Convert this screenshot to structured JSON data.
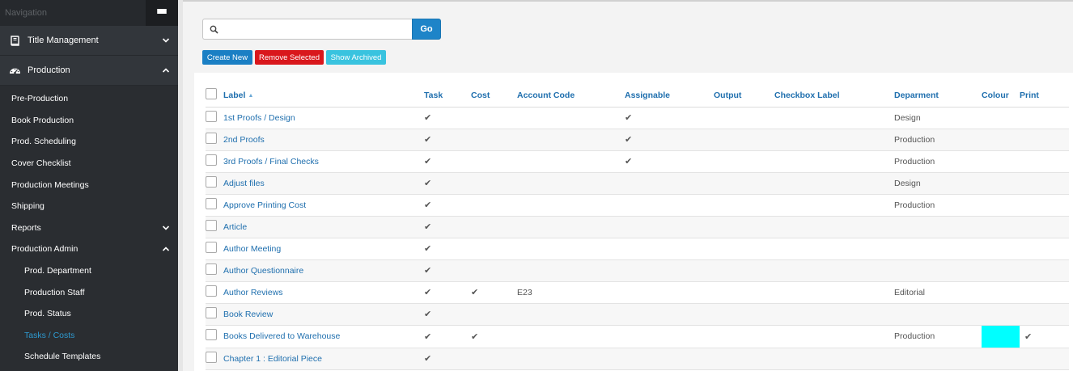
{
  "sidebar": {
    "nav_title": "Navigation",
    "sections": [
      {
        "label": "Title Management",
        "icon": "book-icon",
        "expanded": false
      },
      {
        "label": "Production",
        "icon": "dashboard-icon",
        "expanded": true
      }
    ],
    "items": [
      {
        "label": "Pre-Production",
        "nested": false,
        "chevron": ""
      },
      {
        "label": "Book Production",
        "nested": false,
        "chevron": ""
      },
      {
        "label": "Prod. Scheduling",
        "nested": false,
        "chevron": ""
      },
      {
        "label": "Cover Checklist",
        "nested": false,
        "chevron": ""
      },
      {
        "label": "Production Meetings",
        "nested": false,
        "chevron": ""
      },
      {
        "label": "Shipping",
        "nested": false,
        "chevron": ""
      },
      {
        "label": "Reports",
        "nested": false,
        "chevron": "down"
      },
      {
        "label": "Production Admin",
        "nested": false,
        "chevron": "up"
      },
      {
        "label": "Prod. Department",
        "nested": true,
        "chevron": ""
      },
      {
        "label": "Production Staff",
        "nested": true,
        "chevron": ""
      },
      {
        "label": "Prod. Status",
        "nested": true,
        "chevron": ""
      },
      {
        "label": "Tasks / Costs",
        "nested": true,
        "chevron": "",
        "active": true
      },
      {
        "label": "Schedule Templates",
        "nested": true,
        "chevron": ""
      }
    ]
  },
  "search": {
    "value": "",
    "placeholder": "",
    "go_label": "Go"
  },
  "actions": {
    "create_new": "Create New",
    "remove_selected": "Remove Selected",
    "show_archived": "Show Archived"
  },
  "table": {
    "columns": {
      "label": "Label",
      "task": "Task",
      "cost": "Cost",
      "account_code": "Account Code",
      "assignable": "Assignable",
      "output": "Output",
      "checkbox_label": "Checkbox Label",
      "department": "Deparment",
      "colour": "Colour",
      "print": "Print"
    },
    "sort_column": "label",
    "sort_direction": "ascending",
    "rows": [
      {
        "label": "1st Proofs / Design",
        "task": true,
        "cost": false,
        "account_code": "",
        "assignable": true,
        "output": "",
        "checkbox_label": "",
        "department": "Design",
        "colour": "",
        "print": false
      },
      {
        "label": "2nd Proofs",
        "task": true,
        "cost": false,
        "account_code": "",
        "assignable": true,
        "output": "",
        "checkbox_label": "",
        "department": "Production",
        "colour": "",
        "print": false
      },
      {
        "label": "3rd Proofs / Final Checks",
        "task": true,
        "cost": false,
        "account_code": "",
        "assignable": true,
        "output": "",
        "checkbox_label": "",
        "department": "Production",
        "colour": "",
        "print": false
      },
      {
        "label": "Adjust files",
        "task": true,
        "cost": false,
        "account_code": "",
        "assignable": false,
        "output": "",
        "checkbox_label": "",
        "department": "Design",
        "colour": "",
        "print": false
      },
      {
        "label": "Approve Printing Cost",
        "task": true,
        "cost": false,
        "account_code": "",
        "assignable": false,
        "output": "",
        "checkbox_label": "",
        "department": "Production",
        "colour": "",
        "print": false
      },
      {
        "label": "Article",
        "task": true,
        "cost": false,
        "account_code": "",
        "assignable": false,
        "output": "",
        "checkbox_label": "",
        "department": "",
        "colour": "",
        "print": false
      },
      {
        "label": "Author Meeting",
        "task": true,
        "cost": false,
        "account_code": "",
        "assignable": false,
        "output": "",
        "checkbox_label": "",
        "department": "",
        "colour": "",
        "print": false
      },
      {
        "label": "Author Questionnaire",
        "task": true,
        "cost": false,
        "account_code": "",
        "assignable": false,
        "output": "",
        "checkbox_label": "",
        "department": "",
        "colour": "",
        "print": false
      },
      {
        "label": "Author Reviews",
        "task": true,
        "cost": true,
        "account_code": "E23",
        "assignable": false,
        "output": "",
        "checkbox_label": "",
        "department": "Editorial",
        "colour": "",
        "print": false
      },
      {
        "label": "Book Review",
        "task": true,
        "cost": false,
        "account_code": "",
        "assignable": false,
        "output": "",
        "checkbox_label": "",
        "department": "",
        "colour": "",
        "print": false
      },
      {
        "label": "Books Delivered to Warehouse",
        "task": true,
        "cost": true,
        "account_code": "",
        "assignable": false,
        "output": "",
        "checkbox_label": "",
        "department": "Production",
        "colour": "#00ffff",
        "print": true
      },
      {
        "label": "Chapter 1 : Editorial Piece",
        "task": true,
        "cost": false,
        "account_code": "",
        "assignable": false,
        "output": "",
        "checkbox_label": "",
        "department": "",
        "colour": "",
        "print": false
      }
    ]
  },
  "colors": {
    "accent": "#1e84c8",
    "danger": "#d9171c",
    "info": "#39c3df",
    "active_nav": "#2e9ad0",
    "sidebar_bg": "#2a2d31"
  }
}
